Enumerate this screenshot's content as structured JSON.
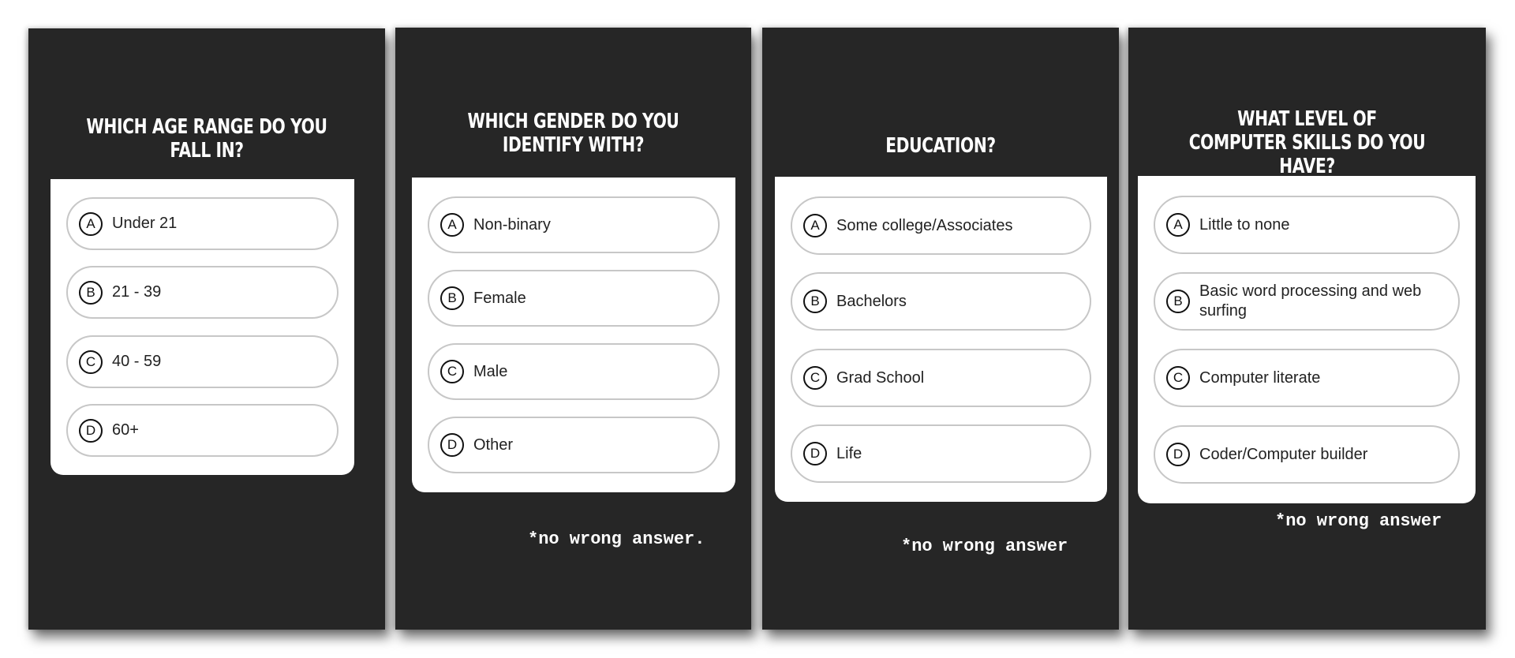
{
  "colors": {
    "panel_bg": "#262626",
    "card_bg": "#ffffff",
    "option_border": "#c7c7c7",
    "text_light": "#ffffff",
    "text_dark": "#222222"
  },
  "panels": [
    {
      "title": "Which age range do you fall in?",
      "options": [
        {
          "letter": "A",
          "label": "Under 21"
        },
        {
          "letter": "B",
          "label": "21 - 39"
        },
        {
          "letter": "C",
          "label": "40 - 59"
        },
        {
          "letter": "D",
          "label": "60+"
        }
      ],
      "note": ""
    },
    {
      "title": "Which gender do you identify with?",
      "options": [
        {
          "letter": "A",
          "label": "Non-binary"
        },
        {
          "letter": "B",
          "label": "Female"
        },
        {
          "letter": "C",
          "label": "Male"
        },
        {
          "letter": "D",
          "label": "Other"
        }
      ],
      "note": "*no wrong answer."
    },
    {
      "title": "Education?",
      "options": [
        {
          "letter": "A",
          "label": "Some college/Associates"
        },
        {
          "letter": "B",
          "label": "Bachelors"
        },
        {
          "letter": "C",
          "label": "Grad School"
        },
        {
          "letter": "D",
          "label": "Life"
        }
      ],
      "note": "*no wrong answer"
    },
    {
      "title": "What level of computer skills do you have?",
      "options": [
        {
          "letter": "A",
          "label": "Little to none"
        },
        {
          "letter": "B",
          "label": "Basic word processing and web surfing"
        },
        {
          "letter": "C",
          "label": "Computer literate"
        },
        {
          "letter": "D",
          "label": "Coder/Computer builder"
        }
      ],
      "note": "*no wrong answer"
    }
  ]
}
